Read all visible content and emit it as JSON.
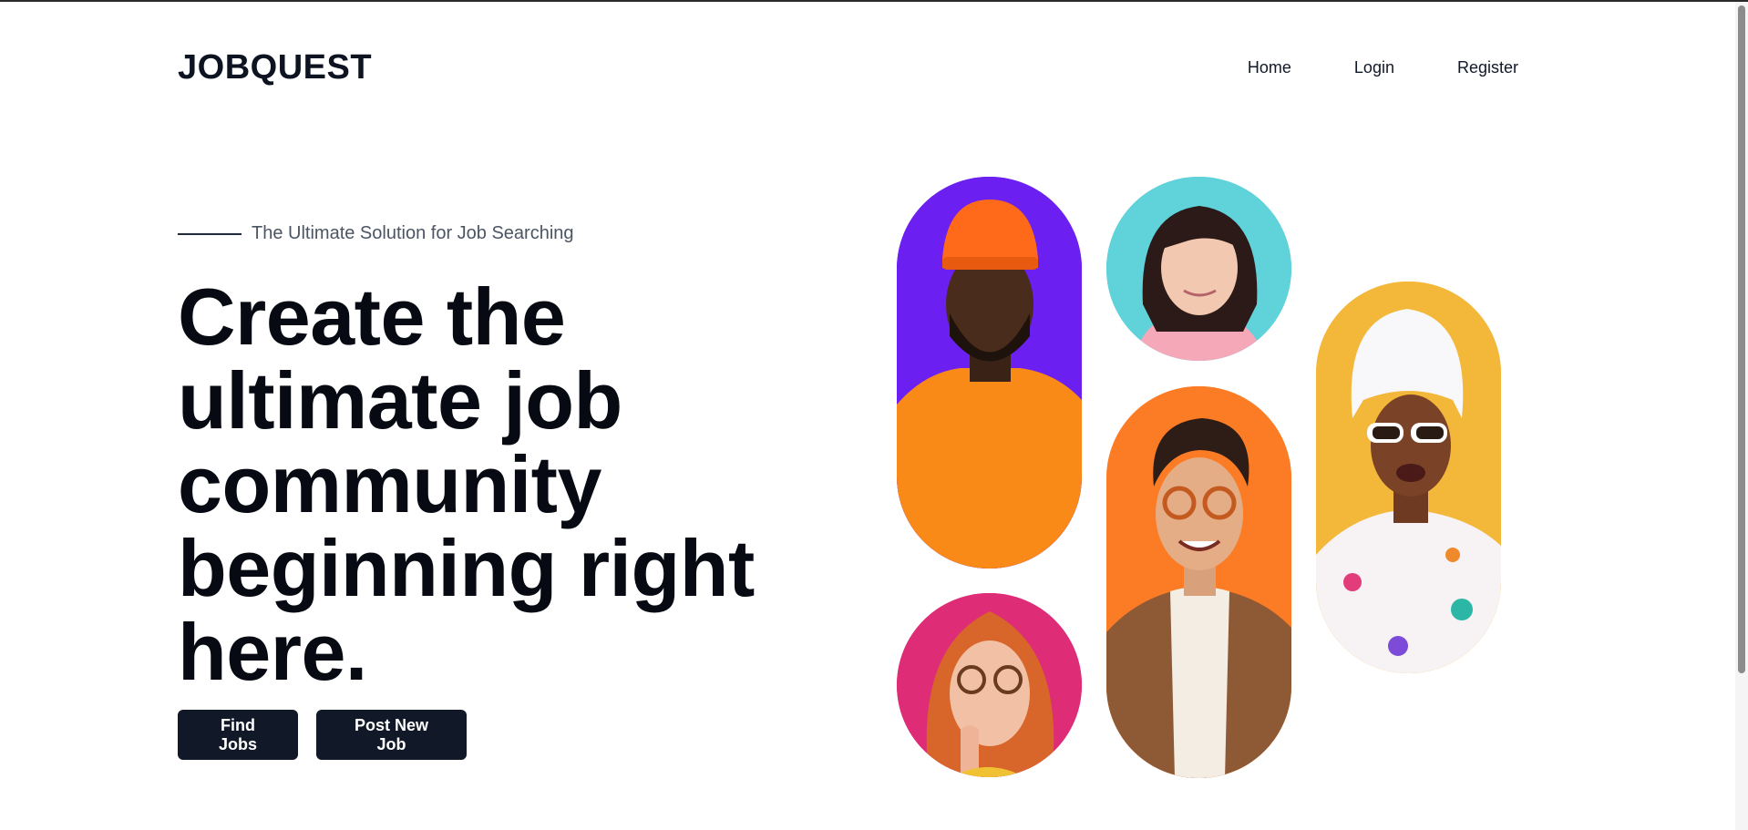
{
  "header": {
    "logo": "JOBQUEST",
    "nav": {
      "home": "Home",
      "login": "Login",
      "register": "Register"
    }
  },
  "hero": {
    "tagline": "The Ultimate Solution for Job Searching",
    "headline": "Create the ultimate job community beginning right here.",
    "buttons": {
      "find_jobs": "Find Jobs",
      "post_job": "Post New Job"
    }
  },
  "portraits": [
    {
      "name": "man-orange-beanie",
      "background": "#6b1ff0"
    },
    {
      "name": "woman-pink-sweater",
      "background": "#5fd2da"
    },
    {
      "name": "woman-head-towel-sunglasses",
      "background": "#f3b73a"
    },
    {
      "name": "woman-red-hair-glasses",
      "background": "#de2c77"
    },
    {
      "name": "man-glasses-brown-jacket",
      "background": "#fb7c25"
    }
  ],
  "colors": {
    "primary": "#111827",
    "text": "#070a12",
    "muted": "#4b5563"
  }
}
